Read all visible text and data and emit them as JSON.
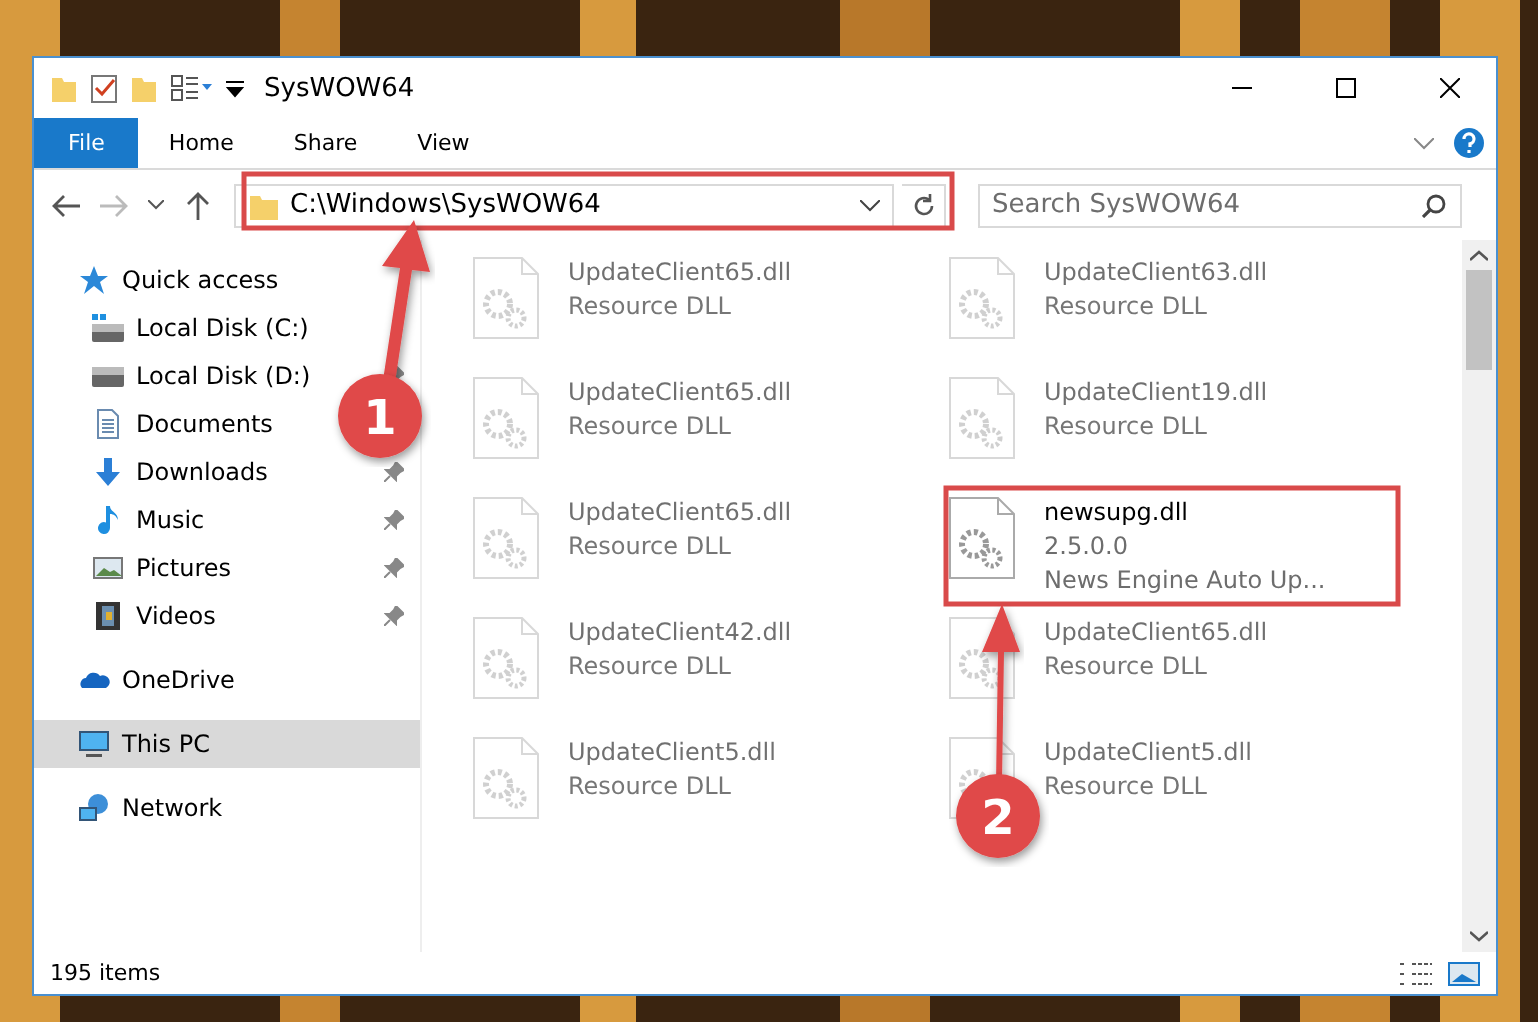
{
  "window": {
    "title": "SysWOW64"
  },
  "ribbon": {
    "tabs": [
      {
        "label": "File",
        "selected": true
      },
      {
        "label": "Home",
        "selected": false
      },
      {
        "label": "Share",
        "selected": false
      },
      {
        "label": "View",
        "selected": false
      }
    ]
  },
  "address": {
    "path": "C:\\Windows\\SysWOW64"
  },
  "search": {
    "placeholder": "Search SysWOW64"
  },
  "sidebar": {
    "items": [
      {
        "label": "Quick access",
        "kind": "quick-access",
        "selected": false,
        "children": [
          {
            "label": "Local Disk (C:)",
            "kind": "drive-windows",
            "pinned": false,
            "selected": false
          },
          {
            "label": "Local Disk (D:)",
            "kind": "drive",
            "pinned": true,
            "selected": false
          },
          {
            "label": "Documents",
            "kind": "documents",
            "pinned": false,
            "selected": false
          },
          {
            "label": "Downloads",
            "kind": "downloads",
            "pinned": true,
            "selected": false
          },
          {
            "label": "Music",
            "kind": "music",
            "pinned": true,
            "selected": false
          },
          {
            "label": "Pictures",
            "kind": "pictures",
            "pinned": true,
            "selected": false
          },
          {
            "label": "Videos",
            "kind": "videos",
            "pinned": true,
            "selected": false
          }
        ]
      },
      {
        "label": "OneDrive",
        "kind": "cloud",
        "selected": false
      },
      {
        "label": "This PC",
        "kind": "computer",
        "selected": true
      },
      {
        "label": "Network",
        "kind": "network",
        "selected": false
      }
    ]
  },
  "files": [
    {
      "name": "UpdateClient65.dll",
      "details": [
        "Resource DLL"
      ],
      "dimmed": true
    },
    {
      "name": "UpdateClient63.dll",
      "details": [
        "Resource DLL"
      ],
      "dimmed": true
    },
    {
      "name": "UpdateClient65.dll",
      "details": [
        "Resource DLL"
      ],
      "dimmed": true
    },
    {
      "name": "UpdateClient19.dll",
      "details": [
        "Resource DLL"
      ],
      "dimmed": true
    },
    {
      "name": "UpdateClient65.dll",
      "details": [
        "Resource DLL"
      ],
      "dimmed": true
    },
    {
      "name": "newsupg.dll",
      "details": [
        "2.5.0.0",
        "News Engine Auto Up..."
      ],
      "dimmed": false
    },
    {
      "name": "UpdateClient42.dll",
      "details": [
        "Resource DLL"
      ],
      "dimmed": true
    },
    {
      "name": "UpdateClient65.dll",
      "details": [
        "Resource DLL"
      ],
      "dimmed": true
    },
    {
      "name": "UpdateClient5.dll",
      "details": [
        "Resource DLL"
      ],
      "dimmed": true
    },
    {
      "name": "UpdateClient5.dll",
      "details": [
        "Resource DLL"
      ],
      "dimmed": true
    }
  ],
  "status_bar": {
    "count": "195 items"
  },
  "annotations": [
    {
      "number": "1"
    },
    {
      "number": "2"
    }
  ]
}
